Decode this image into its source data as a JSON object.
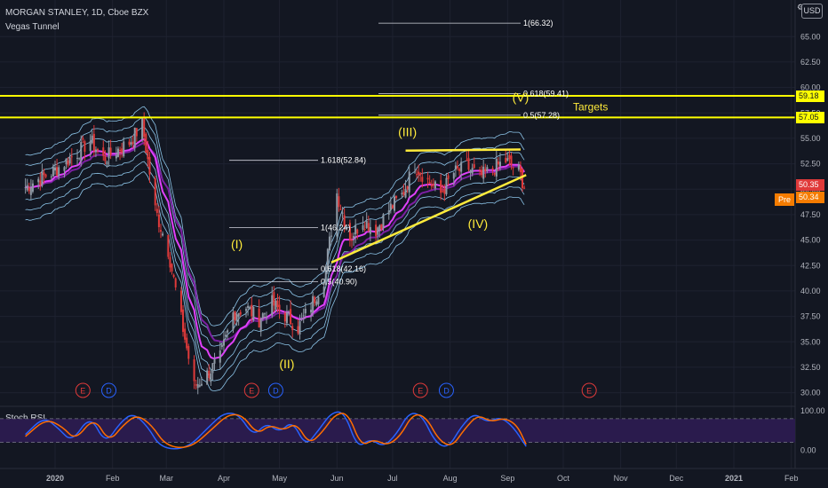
{
  "header": {
    "symbol_line": "MORGAN STANLEY, 1D, Cboe BZX",
    "indicator_line": "Vegas Tunnel"
  },
  "currency_label": "USD",
  "pre_label": "Pre",
  "colors": {
    "background": "#131722",
    "grid": "#1e2230",
    "candle_up": "#8f9aa6",
    "candle_down": "#e03a3a",
    "ema_magenta": "#e040fb",
    "ema_purple": "#7b1fa2",
    "tunnel_blue": "#8cc4e8",
    "annotation_yellow": "#ffeb3b",
    "target_line": "#ffff00",
    "stoch_k": "#2962ff",
    "stoch_d": "#ff6d00",
    "stoch_band": "#2a1b4d",
    "badge_earnings": "#e03a3a",
    "badge_dividend": "#2962ff"
  },
  "chart_data": [
    {
      "type": "candlestick",
      "title": "MORGAN STANLEY, 1D, Cboe BZX",
      "indicator": "Vegas Tunnel",
      "y_axis_ticks": [
        "65.00",
        "62.50",
        "60.00",
        "57.50",
        "55.00",
        "52.50",
        "50.00",
        "47.50",
        "45.00",
        "42.50",
        "40.00",
        "37.50",
        "35.00",
        "32.50",
        "30.00"
      ],
      "y_axis_range": [
        29.0,
        67.0
      ],
      "x_axis_labels": [
        "2020",
        "Feb",
        "Mar",
        "Apr",
        "May",
        "Jun",
        "Jul",
        "Aug",
        "Sep",
        "Oct",
        "Nov",
        "Dec",
        "2021",
        "Feb"
      ],
      "price_path": [
        [
          "2019-12-16",
          50.2
        ],
        [
          "2019-12-23",
          51.0
        ],
        [
          "2019-12-30",
          51.6
        ],
        [
          "2020-01-06",
          52.6
        ],
        [
          "2020-01-13",
          53.6
        ],
        [
          "2020-01-20",
          54.8
        ],
        [
          "2020-01-27",
          53.0
        ],
        [
          "2020-02-03",
          53.8
        ],
        [
          "2020-02-10",
          54.6
        ],
        [
          "2020-02-17",
          56.4
        ],
        [
          "2020-02-24",
          48.0
        ],
        [
          "2020-03-02",
          44.0
        ],
        [
          "2020-03-09",
          37.2
        ],
        [
          "2020-03-16",
          30.6
        ],
        [
          "2020-03-23",
          31.8
        ],
        [
          "2020-03-30",
          33.4
        ],
        [
          "2020-04-06",
          37.8
        ],
        [
          "2020-04-13",
          38.4
        ],
        [
          "2020-04-20",
          37.2
        ],
        [
          "2020-04-27",
          38.8
        ],
        [
          "2020-05-04",
          37.6
        ],
        [
          "2020-05-11",
          36.4
        ],
        [
          "2020-05-18",
          38.6
        ],
        [
          "2020-05-25",
          41.2
        ],
        [
          "2020-06-01",
          49.6
        ],
        [
          "2020-06-08",
          45.2
        ],
        [
          "2020-06-15",
          47.0
        ],
        [
          "2020-06-22",
          46.0
        ],
        [
          "2020-06-29",
          48.0
        ],
        [
          "2020-07-06",
          49.4
        ],
        [
          "2020-07-13",
          52.4
        ],
        [
          "2020-07-20",
          50.8
        ],
        [
          "2020-07-27",
          49.6
        ],
        [
          "2020-08-03",
          51.6
        ],
        [
          "2020-08-10",
          52.2
        ],
        [
          "2020-08-17",
          51.2
        ],
        [
          "2020-08-24",
          52.0
        ],
        [
          "2020-08-31",
          52.8
        ],
        [
          "2020-09-07",
          51.8
        ],
        [
          "2020-09-10",
          50.35
        ]
      ],
      "last_price": "50.35",
      "premarket_price": "50.34",
      "horizontal_levels": [
        {
          "label": "59.18",
          "value": 59.18
        },
        {
          "label": "57.05",
          "value": 57.05
        }
      ],
      "fib_extensions": [
        {
          "label": "1(66.32)",
          "value": 66.32
        },
        {
          "label": "0.618(59.41)",
          "value": 59.41
        },
        {
          "label": "0.5(57.28)",
          "value": 57.28
        },
        {
          "label": "1.618(52.84)",
          "value": 52.84
        },
        {
          "label": "1(46.24)",
          "value": 46.24
        },
        {
          "label": "0.618(42.16)",
          "value": 42.16
        },
        {
          "label": "0.5(40.90)",
          "value": 40.9
        }
      ],
      "wave_labels": [
        {
          "label": "(I)",
          "date": "2020-04-08",
          "value": 44.2
        },
        {
          "label": "(II)",
          "date": "2020-05-05",
          "value": 32.4
        },
        {
          "label": "(III)",
          "date": "2020-07-09",
          "value": 55.2
        },
        {
          "label": "(IV)",
          "date": "2020-08-16",
          "value": 46.2
        },
        {
          "label": "(V)",
          "date": "2020-09-08",
          "value": 58.6
        }
      ],
      "targets_label": "Targets",
      "trendlines": [
        {
          "from": [
            "2020-05-29",
            42.8
          ],
          "to": [
            "2020-09-11",
            51.4
          ]
        },
        {
          "from": [
            "2020-07-08",
            53.8
          ],
          "to": [
            "2020-09-08",
            53.9
          ]
        }
      ],
      "event_badges": [
        {
          "label": "E",
          "kind": "earnings",
          "date": "2020-01-16"
        },
        {
          "label": "D",
          "kind": "dividend",
          "date": "2020-01-30"
        },
        {
          "label": "E",
          "kind": "earnings",
          "date": "2020-04-16"
        },
        {
          "label": "D",
          "kind": "dividend",
          "date": "2020-04-29"
        },
        {
          "label": "E",
          "kind": "earnings",
          "date": "2020-07-16"
        },
        {
          "label": "D",
          "kind": "dividend",
          "date": "2020-07-30"
        },
        {
          "label": "E",
          "kind": "earnings",
          "date": "2020-10-15"
        }
      ]
    },
    {
      "type": "line",
      "title": "Stoch RSI",
      "y_axis_ticks": [
        "100.00",
        "0.00"
      ],
      "y_axis_range": [
        0,
        100
      ],
      "band": [
        20,
        80
      ],
      "series": [
        {
          "name": "K",
          "color": "#2962ff",
          "values": [
            [
              "2019-12-16",
              40
            ],
            [
              "2019-12-26",
              85
            ],
            [
              "2020-01-03",
              55
            ],
            [
              "2020-01-10",
              20
            ],
            [
              "2020-01-20",
              90
            ],
            [
              "2020-01-28",
              15
            ],
            [
              "2020-02-05",
              70
            ],
            [
              "2020-02-12",
              95
            ],
            [
              "2020-02-20",
              60
            ],
            [
              "2020-02-27",
              5
            ],
            [
              "2020-03-12",
              3
            ],
            [
              "2020-03-24",
              60
            ],
            [
              "2020-04-01",
              95
            ],
            [
              "2020-04-09",
              92
            ],
            [
              "2020-04-17",
              35
            ],
            [
              "2020-04-24",
              70
            ],
            [
              "2020-05-01",
              45
            ],
            [
              "2020-05-08",
              75
            ],
            [
              "2020-05-15",
              10
            ],
            [
              "2020-05-22",
              50
            ],
            [
              "2020-05-29",
              96
            ],
            [
              "2020-06-05",
              98
            ],
            [
              "2020-06-12",
              5
            ],
            [
              "2020-06-19",
              30
            ],
            [
              "2020-06-26",
              8
            ],
            [
              "2020-07-03",
              40
            ],
            [
              "2020-07-10",
              97
            ],
            [
              "2020-07-17",
              88
            ],
            [
              "2020-07-24",
              20
            ],
            [
              "2020-07-31",
              5
            ],
            [
              "2020-08-07",
              60
            ],
            [
              "2020-08-14",
              95
            ],
            [
              "2020-08-21",
              70
            ],
            [
              "2020-08-28",
              85
            ],
            [
              "2020-09-04",
              60
            ],
            [
              "2020-09-11",
              10
            ]
          ]
        },
        {
          "name": "D",
          "color": "#ff6d00",
          "values": [
            [
              "2019-12-16",
              35
            ],
            [
              "2019-12-27",
              80
            ],
            [
              "2020-01-05",
              60
            ],
            [
              "2020-01-12",
              25
            ],
            [
              "2020-01-22",
              85
            ],
            [
              "2020-01-30",
              20
            ],
            [
              "2020-02-07",
              65
            ],
            [
              "2020-02-14",
              90
            ],
            [
              "2020-02-22",
              65
            ],
            [
              "2020-03-01",
              10
            ],
            [
              "2020-03-14",
              5
            ],
            [
              "2020-03-26",
              55
            ],
            [
              "2020-04-03",
              90
            ],
            [
              "2020-04-11",
              90
            ],
            [
              "2020-04-19",
              40
            ],
            [
              "2020-04-26",
              65
            ],
            [
              "2020-05-03",
              50
            ],
            [
              "2020-05-10",
              70
            ],
            [
              "2020-05-17",
              15
            ],
            [
              "2020-05-24",
              45
            ],
            [
              "2020-05-31",
              92
            ],
            [
              "2020-06-07",
              95
            ],
            [
              "2020-06-14",
              10
            ],
            [
              "2020-06-21",
              28
            ],
            [
              "2020-06-28",
              12
            ],
            [
              "2020-07-05",
              35
            ],
            [
              "2020-07-12",
              93
            ],
            [
              "2020-07-19",
              85
            ],
            [
              "2020-07-26",
              25
            ],
            [
              "2020-08-02",
              8
            ],
            [
              "2020-08-09",
              55
            ],
            [
              "2020-08-16",
              90
            ],
            [
              "2020-08-23",
              72
            ],
            [
              "2020-08-30",
              82
            ],
            [
              "2020-09-06",
              65
            ],
            [
              "2020-09-11",
              15
            ]
          ]
        }
      ]
    }
  ]
}
